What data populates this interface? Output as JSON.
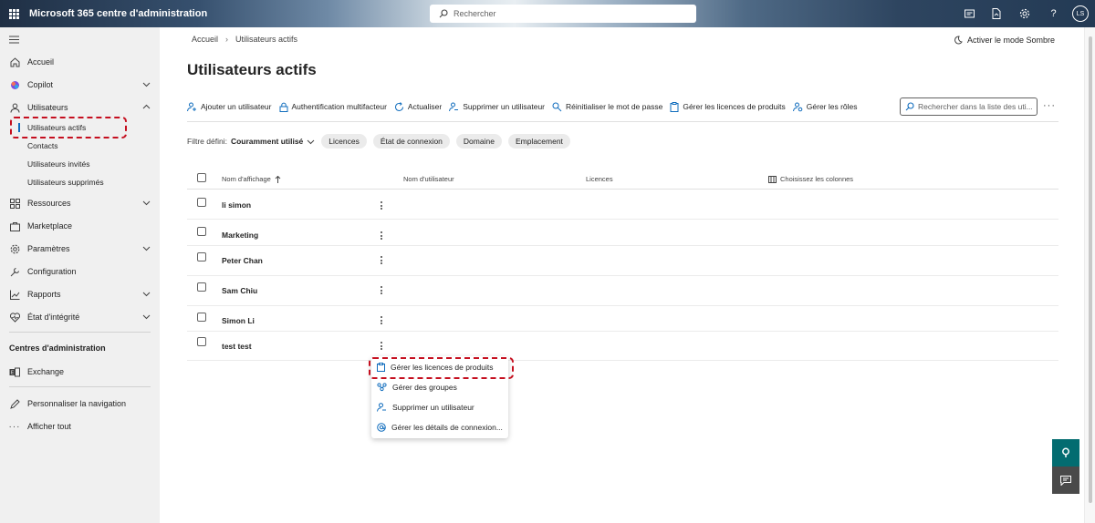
{
  "app": {
    "title": "Microsoft 365 centre d'administration",
    "avatar_initials": "LS"
  },
  "search": {
    "placeholder": "Rechercher"
  },
  "nav": {
    "items": [
      {
        "label": "Accueil",
        "icon": "home-icon"
      },
      {
        "label": "Copilot",
        "icon": "copilot-icon"
      },
      {
        "label": "Utilisateurs",
        "icon": "user-icon"
      },
      {
        "label": "Ressources",
        "icon": "resources-icon"
      },
      {
        "label": "Marketplace",
        "icon": "marketplace-icon"
      },
      {
        "label": "Paramètres",
        "icon": "gear-icon"
      },
      {
        "label": "Configuration",
        "icon": "wrench-icon"
      },
      {
        "label": "Rapports",
        "icon": "chart-icon"
      },
      {
        "label": "État d'intégrité",
        "icon": "heart-icon"
      }
    ],
    "users_sub": [
      "Utilisateurs actifs",
      "Contacts",
      "Utilisateurs invités",
      "Utilisateurs supprimés"
    ],
    "admin_centers_title": "Centres d'administration",
    "exchange": "Exchange",
    "customize": "Personnaliser la navigation",
    "show_all": "Afficher tout"
  },
  "breadcrumb": [
    "Accueil",
    "Utilisateurs actifs"
  ],
  "dark_mode_label": "Activer le mode Sombre",
  "page_title": "Utilisateurs actifs",
  "commands": [
    "Ajouter un utilisateur",
    "Authentification multifacteur",
    "Actualiser",
    "Supprimer un utilisateur",
    "Réinitialiser le mot de passe",
    "Gérer les licences de produits",
    "Gérer les rôles"
  ],
  "list_search_placeholder": "Rechercher dans la liste des uti...",
  "filter": {
    "label": "Filtre défini:",
    "value": "Couramment utilisé",
    "pills": [
      "Licences",
      "État de connexion",
      "Domaine",
      "Emplacement"
    ]
  },
  "table": {
    "columns": [
      "Nom d'affichage",
      "Nom d'utilisateur",
      "Licences",
      "Choisissez les colonnes"
    ],
    "rows": [
      "li simon",
      "Marketing",
      "Peter Chan",
      "Sam Chiu",
      "Simon Li",
      "test test"
    ]
  },
  "context_menu": [
    "Gérer les licences de produits",
    "Gérer des groupes",
    "Supprimer un utilisateur",
    "Gérer les détails de connexion..."
  ],
  "colors": {
    "accent": "#0f6cbd",
    "highlight": "#c50f1f",
    "teal": "#036c70",
    "sidebar_bg": "#f0f0f0"
  }
}
